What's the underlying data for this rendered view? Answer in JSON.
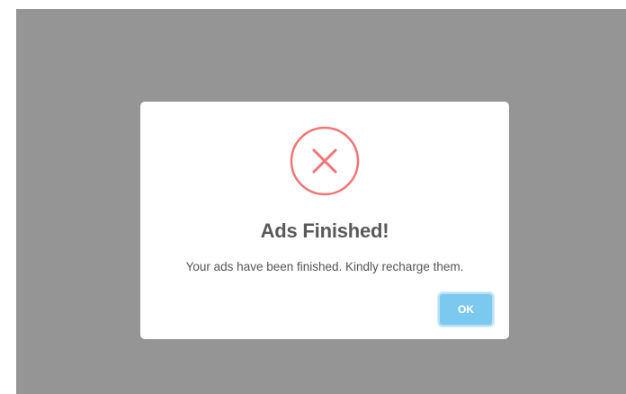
{
  "dialog": {
    "title": "Ads Finished!",
    "message": "Your ads have been finished. Kindly recharge them.",
    "icon": "error-x-circle-icon",
    "ok_label": "OK"
  },
  "colors": {
    "overlay": "#959595",
    "icon": "#f27474",
    "ok_button": "#7cc9f0",
    "title_text": "#595959"
  }
}
